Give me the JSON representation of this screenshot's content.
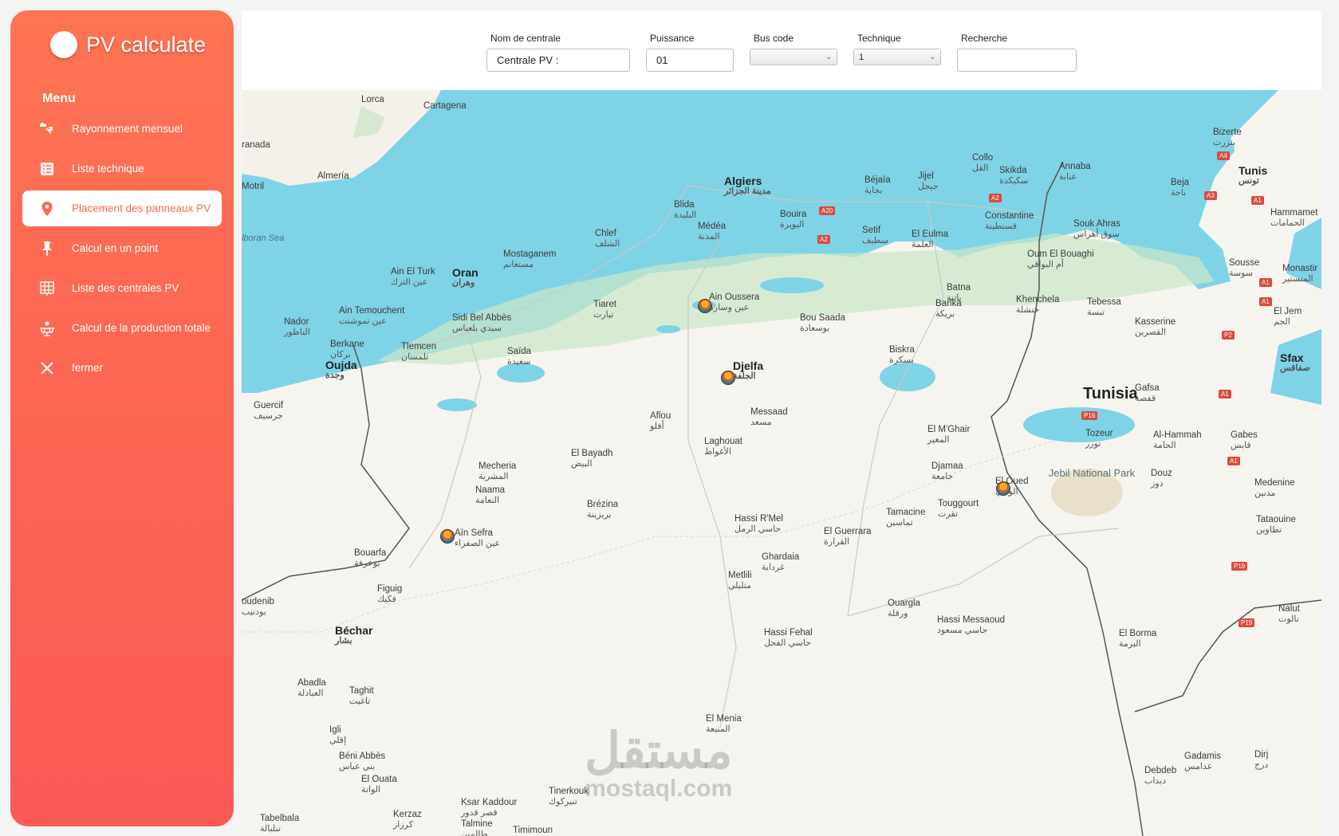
{
  "app": {
    "title": "PV calculate"
  },
  "sidebar": {
    "menu_heading": "Menu",
    "items": [
      {
        "label": "Rayonnement mensuel",
        "icon": "solar-radiation-icon",
        "active": false
      },
      {
        "label": "Liste technique",
        "icon": "list-icon",
        "active": false
      },
      {
        "label": "Placement des panneaux PV",
        "icon": "map-pin-icon",
        "active": true
      },
      {
        "label": "Calcul en un point",
        "icon": "pushpin-icon",
        "active": false
      },
      {
        "label": "Liste des centrales PV",
        "icon": "solar-panel-grid-icon",
        "active": false
      },
      {
        "label": "Calcul de la production totale",
        "icon": "solar-plant-icon",
        "active": false
      },
      {
        "label": "fermer",
        "icon": "close-icon",
        "active": false
      }
    ]
  },
  "form": {
    "nom_centrale": {
      "label": "Nom de centrale",
      "value": "Centrale PV :"
    },
    "puissance": {
      "label": "Puissance",
      "value": "01"
    },
    "bus_code": {
      "label": "Bus code",
      "value": ""
    },
    "technique": {
      "label": "Technique",
      "value": "1"
    },
    "recherche": {
      "label": "Recherche",
      "value": ""
    }
  },
  "map": {
    "country_labels": [
      "Tunisia"
    ],
    "sea_labels": [
      "lboran Sea"
    ],
    "park_label": "Jebil National Park",
    "cities": [
      {
        "id": "lorca",
        "name": "Lorca",
        "ar": ""
      },
      {
        "id": "cartagena",
        "name": "Cartagena",
        "ar": ""
      },
      {
        "id": "granada",
        "name": "ranada",
        "ar": ""
      },
      {
        "id": "almeria",
        "name": "Almería",
        "ar": ""
      },
      {
        "id": "motril",
        "name": "Motril",
        "ar": ""
      },
      {
        "id": "algiers",
        "name": "Algiers",
        "ar": "مدينة الجزائر"
      },
      {
        "id": "blida",
        "name": "Blida",
        "ar": "البليدة"
      },
      {
        "id": "medea",
        "name": "Médéa",
        "ar": "المدية"
      },
      {
        "id": "bouira",
        "name": "Bouira",
        "ar": "البويرة"
      },
      {
        "id": "bejaia",
        "name": "Béjaïa",
        "ar": "بجاية"
      },
      {
        "id": "jijel",
        "name": "Jijel",
        "ar": "جيجل"
      },
      {
        "id": "collo",
        "name": "Collo",
        "ar": "القل"
      },
      {
        "id": "skikda",
        "name": "Skikda",
        "ar": "سكيكدة"
      },
      {
        "id": "annaba",
        "name": "Annaba",
        "ar": "عنابة"
      },
      {
        "id": "bizerte",
        "name": "Bizerte",
        "ar": "بنزرت"
      },
      {
        "id": "tunis",
        "name": "Tunis",
        "ar": "تونس"
      },
      {
        "id": "beja",
        "name": "Beja",
        "ar": "باجة"
      },
      {
        "id": "hammamet",
        "name": "Hammamet",
        "ar": "الحمامات"
      },
      {
        "id": "chlef",
        "name": "Chlef",
        "ar": "الشلف"
      },
      {
        "id": "mostaganem",
        "name": "Mostaganem",
        "ar": "مستغانم"
      },
      {
        "id": "setif",
        "name": "Setif",
        "ar": "سطيف"
      },
      {
        "id": "eleulma",
        "name": "El Eulma",
        "ar": "العلمة"
      },
      {
        "id": "constantine",
        "name": "Constantine",
        "ar": "قسنطينة"
      },
      {
        "id": "soukahras",
        "name": "Souk Ahras",
        "ar": "سوق أهراس"
      },
      {
        "id": "oumelbouaghi",
        "name": "Oum El Bouaghi",
        "ar": "أم البواقي"
      },
      {
        "id": "sousse",
        "name": "Sousse",
        "ar": "سوسة"
      },
      {
        "id": "monastir",
        "name": "Monastir",
        "ar": "المنستير"
      },
      {
        "id": "ainelturk",
        "name": "Ain El Turk",
        "ar": "عين الترك"
      },
      {
        "id": "oran",
        "name": "Oran",
        "ar": "وهران"
      },
      {
        "id": "ainoussera",
        "name": "Ain Oussera",
        "ar": "عين وسارة"
      },
      {
        "id": "tiaret",
        "name": "Tiaret",
        "ar": "تيارت"
      },
      {
        "id": "bousaada",
        "name": "Bou Saada",
        "ar": "بوسعادة"
      },
      {
        "id": "barika",
        "name": "Barika",
        "ar": "بريكة"
      },
      {
        "id": "batna",
        "name": "Batna",
        "ar": "باتنة"
      },
      {
        "id": "khenchela",
        "name": "Khenchela",
        "ar": "خنشلة"
      },
      {
        "id": "tebessa",
        "name": "Tebessa",
        "ar": "تبسة"
      },
      {
        "id": "kasserine",
        "name": "Kasserine",
        "ar": "القصرين"
      },
      {
        "id": "eljem",
        "name": "El Jem",
        "ar": "الجم"
      },
      {
        "id": "aintemouchent",
        "name": "Ain Temouchent",
        "ar": "عين تموشنت"
      },
      {
        "id": "sidibelabbes",
        "name": "Sidi Bel Abbès",
        "ar": "سيدي بلعباس"
      },
      {
        "id": "nador",
        "name": "Nador",
        "ar": "الناظور"
      },
      {
        "id": "berkane",
        "name": "Berkane",
        "ar": "بركان"
      },
      {
        "id": "tlemcen",
        "name": "Tlemcen",
        "ar": "تلمسان"
      },
      {
        "id": "saida",
        "name": "Saïda",
        "ar": "سعيدة"
      },
      {
        "id": "oujda",
        "name": "Oujda",
        "ar": "وجدة"
      },
      {
        "id": "djelfa",
        "name": "Djelfa",
        "ar": "الجلفة"
      },
      {
        "id": "biskra",
        "name": "Biskra",
        "ar": "بسكرة"
      },
      {
        "id": "sfax",
        "name": "Sfax",
        "ar": "صفاقس"
      },
      {
        "id": "guercif",
        "name": "Guercif",
        "ar": "جرسيف"
      },
      {
        "id": "aflou",
        "name": "Aflou",
        "ar": "أفلو"
      },
      {
        "id": "messaad",
        "name": "Messaad",
        "ar": "مسعد"
      },
      {
        "id": "gafsa",
        "name": "Gafsa",
        "ar": "قفصة"
      },
      {
        "id": "elmghair",
        "name": "El M'Ghair",
        "ar": "المغير"
      },
      {
        "id": "tozeur",
        "name": "Tozeur",
        "ar": "توزر"
      },
      {
        "id": "elhammah",
        "name": "Al-Hammah",
        "ar": "الحامة"
      },
      {
        "id": "gabes",
        "name": "Gabes",
        "ar": "قابس"
      },
      {
        "id": "laghouat",
        "name": "Laghouat",
        "ar": "الأغواط"
      },
      {
        "id": "elbayadh",
        "name": "El Bayadh",
        "ar": "البيض"
      },
      {
        "id": "mecheria",
        "name": "Mecheria",
        "ar": "المشرية"
      },
      {
        "id": "djamaa",
        "name": "Djamaa",
        "ar": "جامعة"
      },
      {
        "id": "eloued",
        "name": "El Oued",
        "ar": "الوادي"
      },
      {
        "id": "douz",
        "name": "Douz",
        "ar": "دوز"
      },
      {
        "id": "medenine",
        "name": "Medenine",
        "ar": "مدنين"
      },
      {
        "id": "naama",
        "name": "Naama",
        "ar": "النعامة"
      },
      {
        "id": "brezina",
        "name": "Brézina",
        "ar": "بريزينة"
      },
      {
        "id": "touggourt",
        "name": "Touggourt",
        "ar": "تقرت"
      },
      {
        "id": "tamacine",
        "name": "Tamacine",
        "ar": "تماسين"
      },
      {
        "id": "hassirmel",
        "name": "Hassi R'Mel",
        "ar": "حاسي الرمل"
      },
      {
        "id": "elguerrara",
        "name": "El Guerrara",
        "ar": "القرارة"
      },
      {
        "id": "tataouine",
        "name": "Tataouine",
        "ar": "تطاوين"
      },
      {
        "id": "ainsefra",
        "name": "Aïn Sefra",
        "ar": "عين الصفراء"
      },
      {
        "id": "bouarfa",
        "name": "Bouarfa",
        "ar": "بوعرفة"
      },
      {
        "id": "ghardaia",
        "name": "Ghardaia",
        "ar": "غرداية"
      },
      {
        "id": "metlili",
        "name": "Metlili",
        "ar": "متليلي"
      },
      {
        "id": "figuig",
        "name": "Figuig",
        "ar": "فكيك"
      },
      {
        "id": "boudenib",
        "name": "oudenib",
        "ar": "بودنيب"
      },
      {
        "id": "ouargla",
        "name": "Ouargla",
        "ar": "ورقلة"
      },
      {
        "id": "nalut",
        "name": "Nalut",
        "ar": "نالوت"
      },
      {
        "id": "bechar",
        "name": "Béchar",
        "ar": "بشار"
      },
      {
        "id": "hassifehal",
        "name": "Hassi Fehal",
        "ar": "حاسي الفحل"
      },
      {
        "id": "hassimessaoud",
        "name": "Hassi Messaoud",
        "ar": "حاسي مسعود"
      },
      {
        "id": "elborma",
        "name": "El Borma",
        "ar": "البرمة"
      },
      {
        "id": "abadla",
        "name": "Abadla",
        "ar": "العبادلة"
      },
      {
        "id": "taghit",
        "name": "Taghit",
        "ar": "تاغيت"
      },
      {
        "id": "elmenia",
        "name": "El Menia",
        "ar": "المنيعة"
      },
      {
        "id": "igli",
        "name": "Igli",
        "ar": "إقلي"
      },
      {
        "id": "beniabbes",
        "name": "Béni Abbès",
        "ar": "بني عباس"
      },
      {
        "id": "elouata",
        "name": "El Ouata",
        "ar": "الواتة"
      },
      {
        "id": "ghadamis",
        "name": "Gadamis",
        "ar": "غدامس"
      },
      {
        "id": "dirj",
        "name": "Dirj",
        "ar": "درج"
      },
      {
        "id": "debdeb",
        "name": "Debdeb",
        "ar": "دبداب"
      },
      {
        "id": "tinerkouk",
        "name": "Tinerkouk",
        "ar": "تنيركوك"
      },
      {
        "id": "ksarkaddour",
        "name": "Ksar Kaddour",
        "ar": "قصر قدور"
      },
      {
        "id": "kerzaz",
        "name": "Kerzaz",
        "ar": "كرزاز"
      },
      {
        "id": "tabelbala",
        "name": "Tabelbala",
        "ar": "تبلبالة"
      },
      {
        "id": "talmine",
        "name": "Talmine",
        "ar": "طالمين"
      },
      {
        "id": "timimoun",
        "name": "Timimoun",
        "ar": ""
      }
    ],
    "road_shields": [
      "A4",
      "A3",
      "A1",
      "A2",
      "A20",
      "A2",
      "A1",
      "A1",
      "P2",
      "A1",
      "P16",
      "A1",
      "P19",
      "P19"
    ],
    "markers": [
      "Ain Oussera",
      "Djelfa",
      "El Oued",
      "Aïn Sefra"
    ],
    "watermark": {
      "ar": "مستقل",
      "en": "mostaql.com"
    }
  }
}
